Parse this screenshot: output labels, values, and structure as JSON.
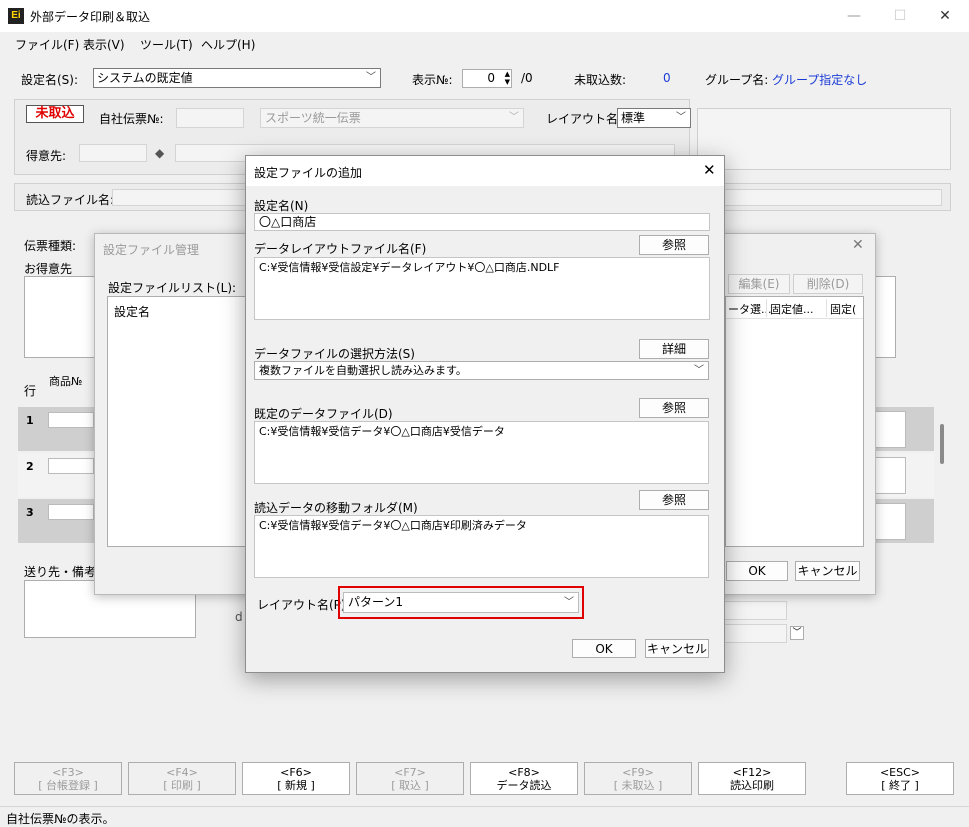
{
  "window": {
    "icon_text": "Ei",
    "title": "外部データ印刷＆取込",
    "minimize": "—",
    "maximize": "☐",
    "close": "✕"
  },
  "menu": [
    "ファイル(F)",
    "表示(V)",
    "ツール(T)",
    "ヘルプ(H)"
  ],
  "toolbar": {
    "setting_label": "設定名(S):",
    "setting_value": "システムの既定値",
    "display_no_label": "表示№:",
    "display_no_value": "0",
    "display_no_total": "/0",
    "unimported_label": "未取込数:",
    "unimported_value": "0",
    "group_label": "グループ名:",
    "group_value": "グループ指定なし"
  },
  "header": {
    "status_badge": "未取込",
    "slip_no_label": "自社伝票№:",
    "slip_type_value": "スポーツ統一伝票",
    "layout_label": "レイアウト名:",
    "layout_value": "標準",
    "customer_label": "得意先:",
    "diamond": "◆"
  },
  "read_file": {
    "label": "読込ファイル名:"
  },
  "main": {
    "slip_kind_label": "伝票種類:",
    "customer_label": "お得意先",
    "row_header": "行",
    "product_no_header": "商品№",
    "rows": [
      "1",
      "2",
      "3"
    ],
    "notes_label": "送り先・備考",
    "partial_label": "d"
  },
  "fkeys": [
    {
      "key": "<F3>",
      "label": "[ 台帳登録 ]"
    },
    {
      "key": "<F4>",
      "label": "[ 印刷 ]"
    },
    {
      "key": "<F6>",
      "label": "[ 新規 ]"
    },
    {
      "key": "<F7>",
      "label": "[ 取込 ]"
    },
    {
      "key": "<F8>",
      "label": "データ読込"
    },
    {
      "key": "<F9>",
      "label": "[ 未取込 ]"
    },
    {
      "key": "<F12>",
      "label": "読込印刷"
    },
    {
      "key": "<ESC>",
      "label": "[ 終了 ]"
    }
  ],
  "status_text": "自社伝票№の表示。",
  "manage_dialog": {
    "title": "設定ファイル管理",
    "list_label": "設定ファイルリスト(L):",
    "list_header": "設定名",
    "edit_button": "編集(E)",
    "delete_button": "削除(D)",
    "columns": [
      "ータ選...",
      "固定値...",
      "固定("
    ],
    "ok_button": "OK",
    "cancel_button": "キャンセル"
  },
  "add_dialog": {
    "title": "設定ファイルの追加",
    "name_label": "設定名(N)",
    "name_value": "〇△口商店",
    "layout_file_label": "データレイアウトファイル名(F)",
    "browse_label": "参照",
    "layout_file_value": "C:¥受信情報¥受信設定¥データレイアウト¥〇△口商店.NDLF",
    "select_method_label": "データファイルの選択方法(S)",
    "detail_label": "詳細",
    "select_method_value": "複数ファイルを自動選択し読み込みます。",
    "default_file_label": "既定のデータファイル(D)",
    "default_file_value": "C:¥受信情報¥受信データ¥〇△口商店¥受信データ",
    "move_folder_label": "読込データの移動フォルダ(M)",
    "move_folder_value": "C:¥受信情報¥受信データ¥〇△口商店¥印刷済みデータ",
    "layout_label": "レイアウト名(P):",
    "layout_value": "パターン1",
    "ok_button": "OK",
    "cancel_button": "キャンセル"
  }
}
